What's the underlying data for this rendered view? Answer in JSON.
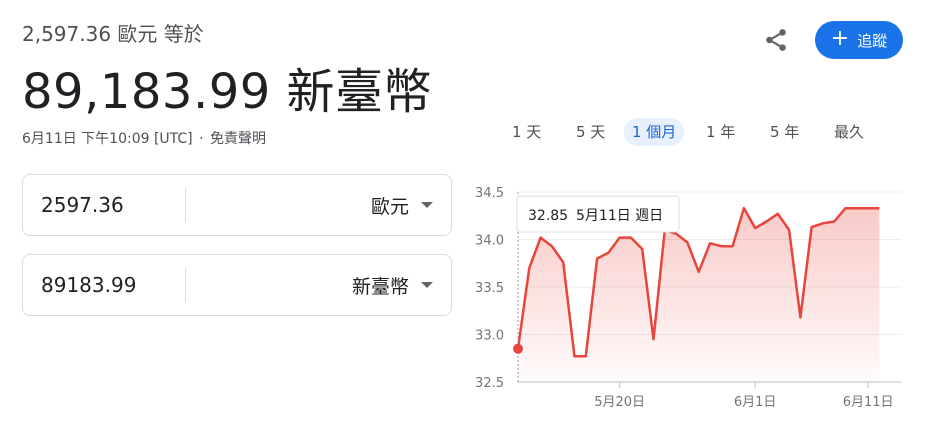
{
  "header": {
    "subtitle": "2,597.36 歐元 等於",
    "headline": "89,183.99 新臺幣",
    "timestamp": "6月11日 下午10:09 [UTC]",
    "separator": "·",
    "disclaimer": "免責聲明"
  },
  "actions": {
    "share_icon": "share-icon",
    "follow_label": "追蹤",
    "follow_icon": "+"
  },
  "converter": {
    "from": {
      "amount": "2597.36",
      "currency": "歐元"
    },
    "to": {
      "amount": "89183.99",
      "currency": "新臺幣"
    }
  },
  "range_tabs": [
    "1 天",
    "5 天",
    "1 個月",
    "1 年",
    "5 年",
    "最久"
  ],
  "active_tab_index": 2,
  "tooltip": {
    "value": "32.85",
    "date": "5月11日 週日"
  },
  "colors": {
    "line": "#e8453c",
    "accent": "#1a73e8",
    "tab_active_bg": "#e8f0fe",
    "tab_active_text": "#1967d2"
  },
  "chart_data": {
    "type": "area",
    "y_ticks": [
      "34.5",
      "34.0",
      "33.5",
      "33.0",
      "32.5"
    ],
    "y_tick_values": [
      34.5,
      34.0,
      33.5,
      33.0,
      32.5
    ],
    "x_tick_labels": [
      "5月20日",
      "6月1日",
      "6月11日"
    ],
    "x_tick_days": [
      9,
      21,
      31
    ],
    "ylim": [
      32.5,
      34.5
    ],
    "xlim": [
      0,
      34
    ],
    "series": [
      {
        "x": [
          0,
          1,
          2,
          3,
          4,
          5,
          6,
          7,
          8,
          9,
          10,
          11,
          12,
          13,
          14,
          15,
          16,
          17,
          18,
          19,
          20,
          21,
          22,
          23,
          24,
          25,
          26,
          27,
          28,
          29,
          30,
          31,
          32
        ],
        "y": [
          32.85,
          33.7,
          34.02,
          33.93,
          33.76,
          32.77,
          32.77,
          33.8,
          33.86,
          34.02,
          34.02,
          33.9,
          32.95,
          34.1,
          34.06,
          33.97,
          33.66,
          33.96,
          33.93,
          33.93,
          34.33,
          34.12,
          34.19,
          34.27,
          34.1,
          33.18,
          34.13,
          34.17,
          34.19,
          34.33,
          34.33,
          34.33,
          34.33
        ]
      }
    ]
  }
}
